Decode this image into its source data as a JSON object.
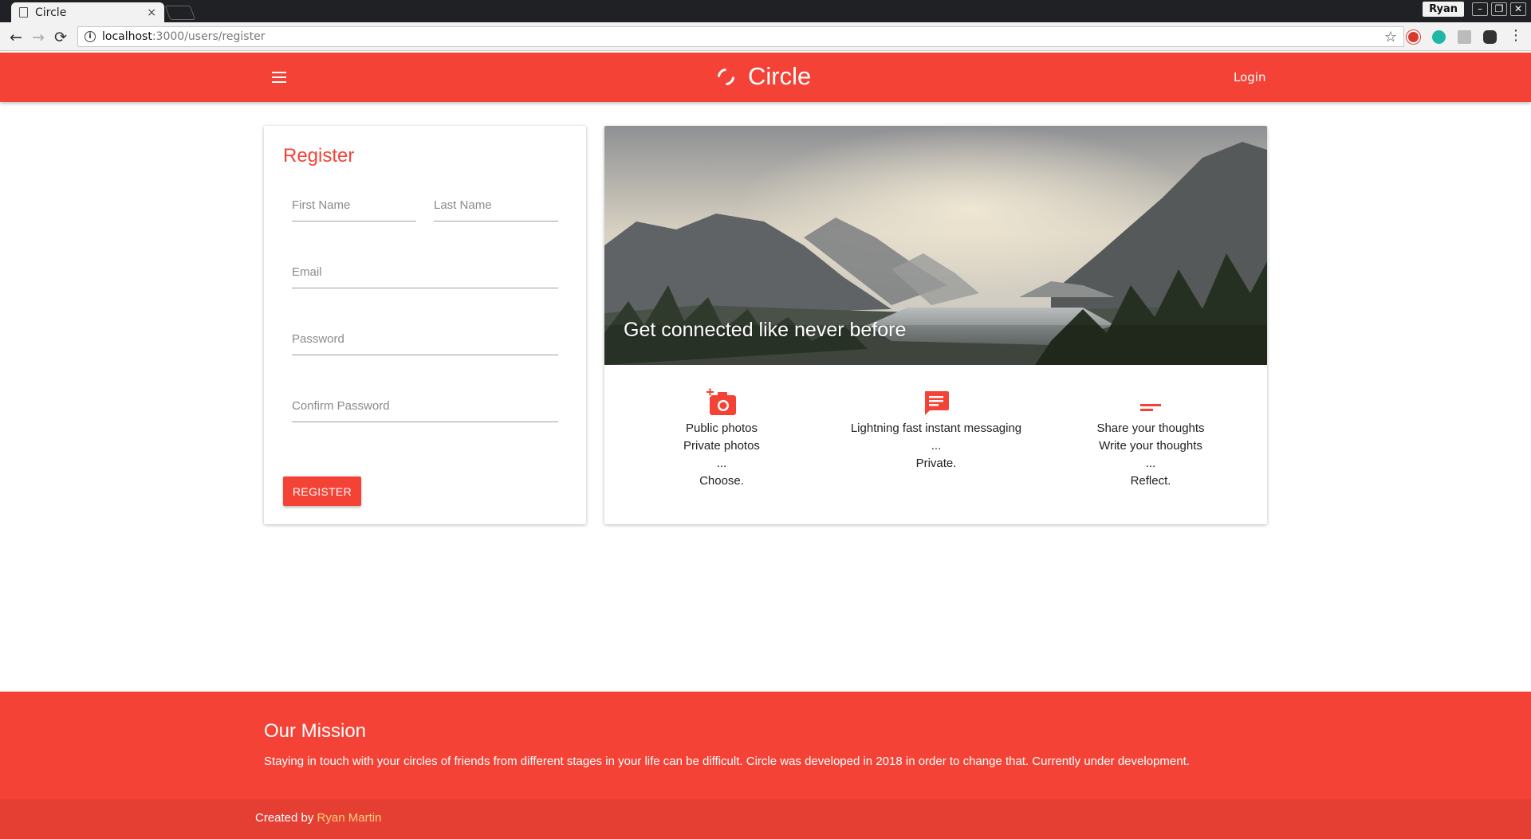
{
  "browser": {
    "tab_title": "Circle",
    "tab_close": "×",
    "profile_name": "Ryan",
    "url_host": "localhost",
    "url_path": ":3000/users/register",
    "window_controls": [
      "–",
      "❐",
      "✕"
    ],
    "nav": {
      "back": "←",
      "forward": "→",
      "reload": "⟳",
      "info": "i",
      "bookmark": "☆"
    },
    "extensions": [
      "ublock-icon",
      "m-extension-icon",
      "gray-extension-icon",
      "dark-extension-icon",
      "menu-dots-icon"
    ]
  },
  "header": {
    "app_name": "Circle",
    "login_label": "Login",
    "menu_icon": "hamburger-icon",
    "logo_icon": "circle-logo-icon"
  },
  "register": {
    "title": "Register",
    "first_name_placeholder": "First Name",
    "last_name_placeholder": "Last Name",
    "email_placeholder": "Email",
    "password_placeholder": "Password",
    "confirm_password_placeholder": "Confirm Password",
    "button_label": "REGISTER"
  },
  "hero": {
    "caption": "Get connected like never before"
  },
  "features": [
    {
      "icon": "add-a-photo-icon",
      "lines": [
        "Public photos",
        "Private photos",
        "...",
        "Choose."
      ]
    },
    {
      "icon": "chat-message-icon",
      "lines": [
        "Lightning fast instant messaging",
        "...",
        "Private."
      ]
    },
    {
      "icon": "short-text-icon",
      "lines": [
        "Share your thoughts",
        "Write your thoughts",
        "...",
        "Reflect."
      ]
    }
  ],
  "footer": {
    "mission_title": "Our Mission",
    "mission_text": "Staying in touch with your circles of friends from different stages in your life can be difficult. Circle was developed in 2018 in order to change that. Currently under development.",
    "created_by": "Created by",
    "author": "Ryan Martin"
  },
  "colors": {
    "primary": "#f44336",
    "footer_bottom": "#e53f34",
    "author_link": "#ffd07a"
  }
}
